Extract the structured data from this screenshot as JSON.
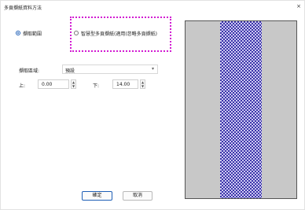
{
  "window": {
    "title": "多頁擷紙資料方法",
    "close_glyph": "×"
  },
  "mode": {
    "option1_label": "擷取範圍",
    "option2_label": "智慧型多頁擷紙(適用(忽略多頁擷紙)"
  },
  "range": {
    "label": "擷取區域:",
    "selected": "預設",
    "top_label": "上:",
    "top_value": "0.00",
    "bottom_label": "下:",
    "bottom_value": "14.00"
  },
  "buttons": {
    "ok": "確定",
    "cancel": "取消"
  },
  "colors": {
    "accent": "#1f5fb6",
    "highlight_border": "#d21ad2",
    "pattern": "#3b34a8"
  }
}
